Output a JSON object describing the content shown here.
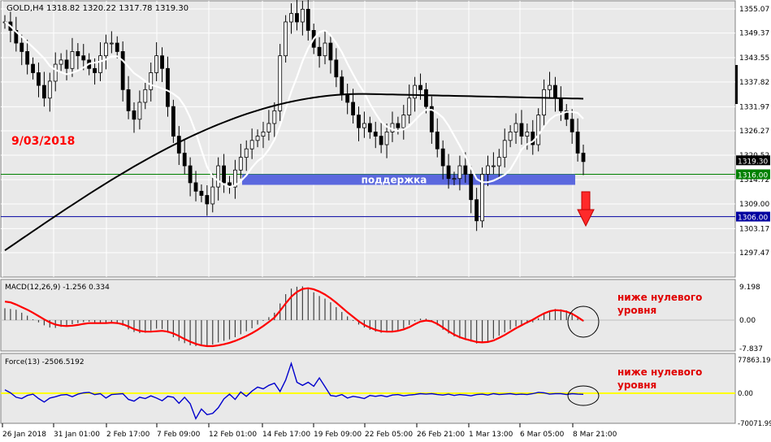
{
  "chart_data": [
    {
      "type": "candlestick",
      "title": "GOLD,H4  1318.82 1320.22 1317.78 1319.30",
      "annotation_date": "9/03/2018",
      "support_label": "поддержка",
      "ylim": [
        1297.47,
        1355.07
      ],
      "yticks": [
        "1355.07",
        "1349.37",
        "1343.55",
        "1337.82",
        "1331.97",
        "1326.27",
        "1320.52",
        "1314.72",
        "1309.00",
        "1303.17",
        "1297.47"
      ],
      "price_labels": {
        "current": "1319.30",
        "support": "1316.00",
        "level": "1306.00"
      },
      "xticks": [
        "26 Jan 2018",
        "31 Jan 01:00",
        "2 Feb 17:00",
        "7 Feb 09:00",
        "12 Feb 01:00",
        "14 Feb 17:00",
        "19 Feb 09:00",
        "22 Feb 05:00",
        "26 Feb 21:00",
        "1 Mar 13:00",
        "6 Mar 05:00",
        "8 Mar 21:00"
      ],
      "close": [
        1352,
        1350,
        1347,
        1345,
        1342,
        1340,
        1337,
        1334,
        1338,
        1342,
        1343,
        1341,
        1345,
        1344,
        1343,
        1341,
        1340,
        1344,
        1347,
        1347,
        1345,
        1336,
        1331,
        1329,
        1333,
        1336,
        1340,
        1344,
        1341,
        1332,
        1325,
        1321,
        1318,
        1314,
        1312,
        1311,
        1309,
        1313,
        1318,
        1314,
        1313,
        1317,
        1320,
        1322,
        1324,
        1325,
        1326,
        1328,
        1331,
        1344,
        1352,
        1354,
        1352,
        1355,
        1350,
        1346,
        1344,
        1347,
        1343,
        1339,
        1335,
        1333,
        1330,
        1327,
        1328,
        1326,
        1325,
        1323,
        1326,
        1328,
        1327,
        1330,
        1334,
        1337,
        1336,
        1332,
        1326,
        1322,
        1318,
        1315,
        1315,
        1318,
        1316,
        1310,
        1305,
        1316,
        1318,
        1318,
        1320,
        1324,
        1326,
        1328,
        1325,
        1326,
        1323,
        1330,
        1336,
        1337,
        1334,
        1331,
        1329,
        1326,
        1321,
        1319
      ],
      "colors": {
        "background": "#e9e9e9",
        "grid": "#ffffff",
        "candles": "#000000",
        "ma_fast": "#ffffff",
        "ma_slow": "#000000",
        "support_zone": "#5b68de",
        "support_line": "#008000",
        "level_line": "#0000a0",
        "date_text": "#ff0000",
        "note_text": "#e00000",
        "signal_line": "#ff0000",
        "force_line": "#0000cc",
        "zero_line": "#ffff00"
      }
    },
    {
      "type": "macd",
      "title": "MACD(12,26,9) -1.256 0.334",
      "ylim": [
        -7.837,
        9.198
      ],
      "yticks": [
        "9.198",
        "0.00",
        "-7.837"
      ],
      "histogram": [
        3.2,
        3,
        2.8,
        2,
        1.2,
        0.2,
        -0.6,
        -1.4,
        -2,
        -2.1,
        -1.8,
        -1.5,
        -1.1,
        -0.8,
        -0.5,
        -0.4,
        -0.6,
        -0.8,
        -0.8,
        -0.5,
        -0.8,
        -1.5,
        -2.5,
        -3.2,
        -3.5,
        -3.4,
        -2.8,
        -2.3,
        -2.4,
        -3.4,
        -4.6,
        -5.6,
        -6.2,
        -6.8,
        -7,
        -6.9,
        -6.8,
        -6.6,
        -6,
        -5.6,
        -5.2,
        -4.6,
        -3.8,
        -3,
        -2.2,
        -1.2,
        -0.2,
        0.8,
        2,
        4.5,
        7,
        8.5,
        9,
        9.1,
        8.5,
        7.5,
        6.5,
        5.8,
        4.8,
        3.5,
        2.2,
        1,
        -0.2,
        -1.2,
        -2,
        -2.6,
        -3.1,
        -3.4,
        -3.3,
        -3.1,
        -2.8,
        -2.2,
        -1.3,
        -0.3,
        0.4,
        0.4,
        -0.4,
        -1.4,
        -2.6,
        -3.6,
        -4.4,
        -4.9,
        -5.3,
        -5.8,
        -6.3,
        -6.2,
        -5.7,
        -5,
        -4.2,
        -3.3,
        -2.5,
        -1.7,
        -1.2,
        -0.9,
        -0.6,
        0.5,
        1.7,
        2.6,
        3,
        2.9,
        2.6,
        2,
        0.9,
        -0.3
      ],
      "signal": [
        5,
        4.8,
        4.2,
        3.5,
        2.8,
        2,
        1.1,
        0.2,
        -0.6,
        -1.2,
        -1.5,
        -1.6,
        -1.5,
        -1.3,
        -1,
        -0.8,
        -0.8,
        -0.8,
        -0.8,
        -0.7,
        -0.8,
        -1.1,
        -1.7,
        -2.4,
        -2.9,
        -3.1,
        -3.1,
        -3,
        -2.9,
        -3.1,
        -3.6,
        -4.3,
        -5.1,
        -5.8,
        -6.4,
        -6.8,
        -7,
        -7,
        -6.8,
        -6.5,
        -6.1,
        -5.6,
        -5,
        -4.3,
        -3.5,
        -2.6,
        -1.6,
        -0.5,
        0.7,
        2.5,
        4.5,
        6.3,
        7.6,
        8.4,
        8.6,
        8.3,
        7.7,
        6.9,
        5.9,
        4.7,
        3.4,
        2.1,
        0.9,
        -0.3,
        -1.3,
        -2,
        -2.6,
        -3,
        -3.1,
        -3.1,
        -2.9,
        -2.5,
        -1.9,
        -1.1,
        -0.4,
        -0.1,
        -0.3,
        -1,
        -2,
        -3,
        -3.9,
        -4.6,
        -5.1,
        -5.5,
        -5.9,
        -6,
        -5.9,
        -5.5,
        -4.8,
        -4,
        -3.1,
        -2.2,
        -1.4,
        -0.6,
        0.1,
        1,
        1.8,
        2.4,
        2.7,
        2.6,
        2.3,
        1.7,
        0.8,
        -0.2
      ],
      "note": "ниже нулевого уровня"
    },
    {
      "type": "force",
      "title": "Force(13) -2506.5192",
      "ylim": [
        -70071.99,
        77863.19
      ],
      "yticks": [
        "77863.19",
        "0.00",
        "-70071.99"
      ],
      "values": [
        8000,
        1000,
        -9000,
        -12000,
        -5000,
        -2000,
        -12000,
        -20000,
        -11000,
        -8000,
        -4000,
        -3000,
        -8000,
        -2000,
        1000,
        2000,
        -3000,
        -1000,
        -11000,
        -3000,
        -2000,
        -1000,
        -14000,
        -18000,
        -9000,
        -12000,
        -6000,
        -11000,
        -17000,
        -7000,
        -9000,
        -23000,
        -9000,
        -24000,
        -58000,
        -36000,
        -49000,
        -46000,
        -33000,
        -13000,
        -2000,
        -14000,
        3000,
        -7000,
        5000,
        14000,
        10000,
        18000,
        23000,
        4000,
        30000,
        68000,
        25000,
        18000,
        25000,
        16000,
        35000,
        15000,
        -5000,
        -7000,
        -3000,
        -11000,
        -7000,
        -9000,
        -12000,
        -5000,
        -7000,
        -5000,
        -8000,
        -4000,
        -3000,
        -6000,
        -4000,
        -3000,
        -1000,
        -2000,
        -1000,
        -3000,
        -4000,
        -2000,
        -5000,
        -3000,
        -4000,
        -6000,
        -3000,
        -2000,
        -4000,
        -1000,
        -3000,
        -2000,
        -1000,
        -3000,
        -2000,
        -3000,
        -1000,
        2000,
        1000,
        -2000,
        -1000,
        -1000,
        -3000,
        -1000,
        -2000,
        -2500
      ],
      "note": "ниже нулевого уровня"
    }
  ]
}
